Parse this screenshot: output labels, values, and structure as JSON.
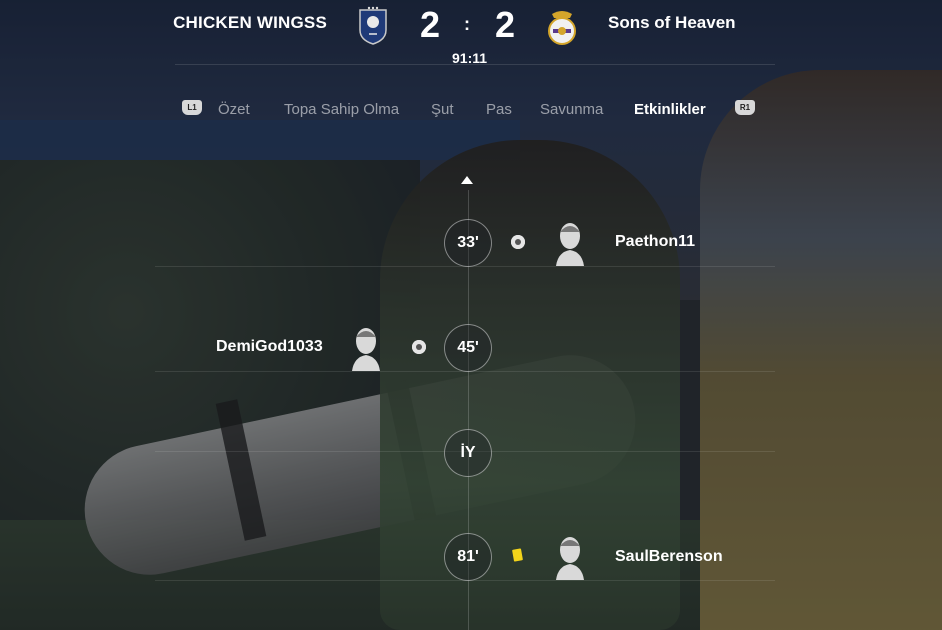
{
  "match": {
    "home_team": "CHICKEN WINGSS",
    "away_team": "Sons of Heaven",
    "home_score": "2",
    "away_score": "2",
    "separator": ":",
    "clock": "91:11"
  },
  "tabs": {
    "left_bumper": "L1",
    "right_bumper": "R1",
    "items": [
      {
        "label": "Özet",
        "active": false
      },
      {
        "label": "Topa Sahip Olma",
        "active": false
      },
      {
        "label": "Şut",
        "active": false
      },
      {
        "label": "Pas",
        "active": false
      },
      {
        "label": "Savunma",
        "active": false
      },
      {
        "label": "Etkinlikler",
        "active": true
      }
    ]
  },
  "events": [
    {
      "minute": "33'",
      "side": "away",
      "type": "goal-icon",
      "player": "Paethon11"
    },
    {
      "minute": "45'",
      "side": "home",
      "type": "goal-icon",
      "player": "DemiGod1033"
    },
    {
      "minute": "İY",
      "side": "none",
      "type": "half-time",
      "player": ""
    },
    {
      "minute": "81'",
      "side": "away",
      "type": "yellow-card-icon",
      "player": "SaulBerenson"
    }
  ],
  "colors": {
    "active_tab": "#ffffff",
    "inactive_tab": "#8c8f94",
    "yellow_card": "#f3d41a"
  }
}
